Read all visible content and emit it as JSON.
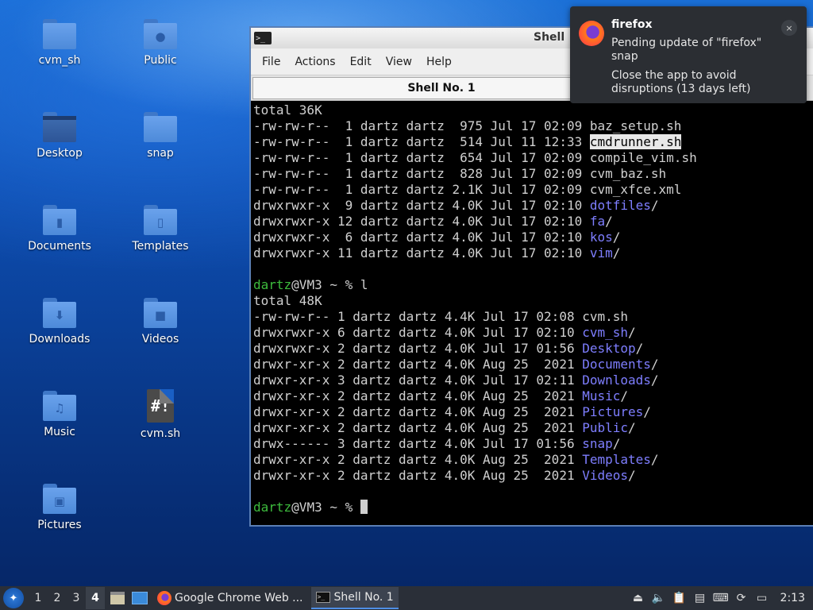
{
  "desktop": {
    "icons": [
      {
        "label": "cvm_sh",
        "icon": "folder-icon"
      },
      {
        "label": "Public",
        "icon": "folder-public-icon"
      },
      {
        "label": "Desktop",
        "icon": "folder-desktop-icon"
      },
      {
        "label": "snap",
        "icon": "folder-icon"
      },
      {
        "label": "Documents",
        "icon": "folder-documents-icon"
      },
      {
        "label": "Templates",
        "icon": "folder-templates-icon"
      },
      {
        "label": "Downloads",
        "icon": "folder-downloads-icon"
      },
      {
        "label": "Videos",
        "icon": "folder-videos-icon"
      },
      {
        "label": "Music",
        "icon": "folder-music-icon"
      },
      {
        "label": "cvm.sh",
        "icon": "shell-script-icon"
      },
      {
        "label": "Pictures",
        "icon": "folder-pictures-icon"
      }
    ]
  },
  "terminal": {
    "title": "Shell",
    "menu": [
      "File",
      "Actions",
      "Edit",
      "View",
      "Help"
    ],
    "tab_label": "Shell No. 1",
    "lines": [
      "total 36K",
      "-rw-rw-r--  1 dartz dartz  975 Jul 17 02:09 baz_setup.sh",
      "-rw-rw-r--  1 dartz dartz  514 Jul 11 12:33 cmdrunner.sh",
      "-rw-rw-r--  1 dartz dartz  654 Jul 17 02:09 compile_vim.sh",
      "-rw-rw-r--  1 dartz dartz  828 Jul 17 02:09 cvm_baz.sh",
      "-rw-rw-r--  1 dartz dartz 2.1K Jul 17 02:09 cvm_xfce.xml",
      "drwxrwxr-x  9 dartz dartz 4.0K Jul 17 02:10 dotfiles/",
      "drwxrwxr-x 12 dartz dartz 4.0K Jul 17 02:10 fa/",
      "drwxrwxr-x  6 dartz dartz 4.0K Jul 17 02:10 kos/",
      "drwxrwxr-x 11 dartz dartz 4.0K Jul 17 02:10 vim/",
      "",
      "dartz@VM3 ~ % l",
      "total 48K",
      "-rw-rw-r-- 1 dartz dartz 4.4K Jul 17 02:08 cvm.sh",
      "drwxrwxr-x 6 dartz dartz 4.0K Jul 17 02:10 cvm_sh/",
      "drwxrwxr-x 2 dartz dartz 4.0K Jul 17 01:56 Desktop/",
      "drwxr-xr-x 2 dartz dartz 4.0K Aug 25  2021 Documents/",
      "drwxr-xr-x 3 dartz dartz 4.0K Jul 17 02:11 Downloads/",
      "drwxr-xr-x 2 dartz dartz 4.0K Aug 25  2021 Music/",
      "drwxr-xr-x 2 dartz dartz 4.0K Aug 25  2021 Pictures/",
      "drwxr-xr-x 2 dartz dartz 4.0K Aug 25  2021 Public/",
      "drwx------ 3 dartz dartz 4.0K Jul 17 01:56 snap/",
      "drwxr-xr-x 2 dartz dartz 4.0K Aug 25  2021 Templates/",
      "drwxr-xr-x 2 dartz dartz 4.0K Aug 25  2021 Videos/",
      "",
      "dartz@VM3 ~ % "
    ],
    "colors": {
      "directory": "#7e7eff",
      "prompt_user": "#3dbb3d",
      "text": "#d0d0d0"
    }
  },
  "notification": {
    "app": "firefox",
    "message": "Pending update of \"firefox\" snap",
    "detail": "Close the app to avoid disruptions (13 days left)",
    "close_glyph": "×"
  },
  "taskbar": {
    "workspaces": [
      "1",
      "2",
      "3",
      "4"
    ],
    "active_workspace": "4",
    "tasks": [
      {
        "label": "Google Chrome Web ...",
        "icon": "firefox-icon"
      },
      {
        "label": "Shell No. 1",
        "icon": "terminal-icon"
      }
    ],
    "clock": "2:13"
  }
}
